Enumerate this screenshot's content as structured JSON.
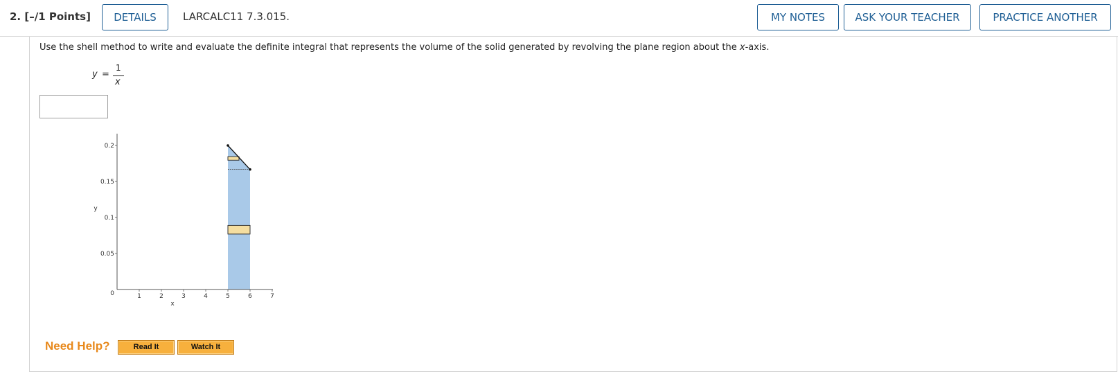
{
  "header": {
    "question_label": "2.  [–/1 Points]",
    "details_label": "DETAILS",
    "question_id": "LARCALC11 7.3.015.",
    "my_notes_label": "MY NOTES",
    "ask_teacher_label": "ASK YOUR TEACHER",
    "practice_another_label": "PRACTICE ANOTHER",
    "accent_color": "#1f5f95"
  },
  "question": {
    "prompt_before": "Use the shell method to write and evaluate the definite integral that represents the volume of the solid generated by revolving the plane region about the ",
    "prompt_axis": "x",
    "prompt_after": "-axis.",
    "equation": {
      "lhs": "y",
      "equals": "=",
      "numerator": "1",
      "denominator": "x"
    },
    "answer_value": ""
  },
  "chart_data": {
    "type": "area",
    "xlabel": "x",
    "ylabel": "y",
    "xlim": [
      0,
      7
    ],
    "ylim": [
      0,
      0.2
    ],
    "x_ticks": [
      "1",
      "2",
      "3",
      "4",
      "5",
      "6",
      "7"
    ],
    "y_ticks": [
      "0",
      "0.05",
      "0.1",
      "0.15",
      "0.2"
    ],
    "curve": {
      "x": [
        5,
        6
      ],
      "y": [
        0.2,
        0.1667
      ]
    },
    "shaded_region": {
      "x_from": 5,
      "x_to": 6,
      "y_from": 0,
      "y_to_curve": true
    },
    "shell_rectangles": [
      {
        "x_from": 5,
        "x_to": 5.5,
        "y_center": 0.182,
        "y_height": 0.005
      },
      {
        "x_from": 5,
        "x_to": 6,
        "y_center": 0.083,
        "y_height": 0.012
      }
    ],
    "region_color": "#a9c9e8",
    "shell_color": "#f5dea0"
  },
  "help": {
    "label": "Need Help?",
    "read_label": "Read It",
    "watch_label": "Watch It",
    "label_color": "#e8891c",
    "button_color": "#f7b03d"
  }
}
